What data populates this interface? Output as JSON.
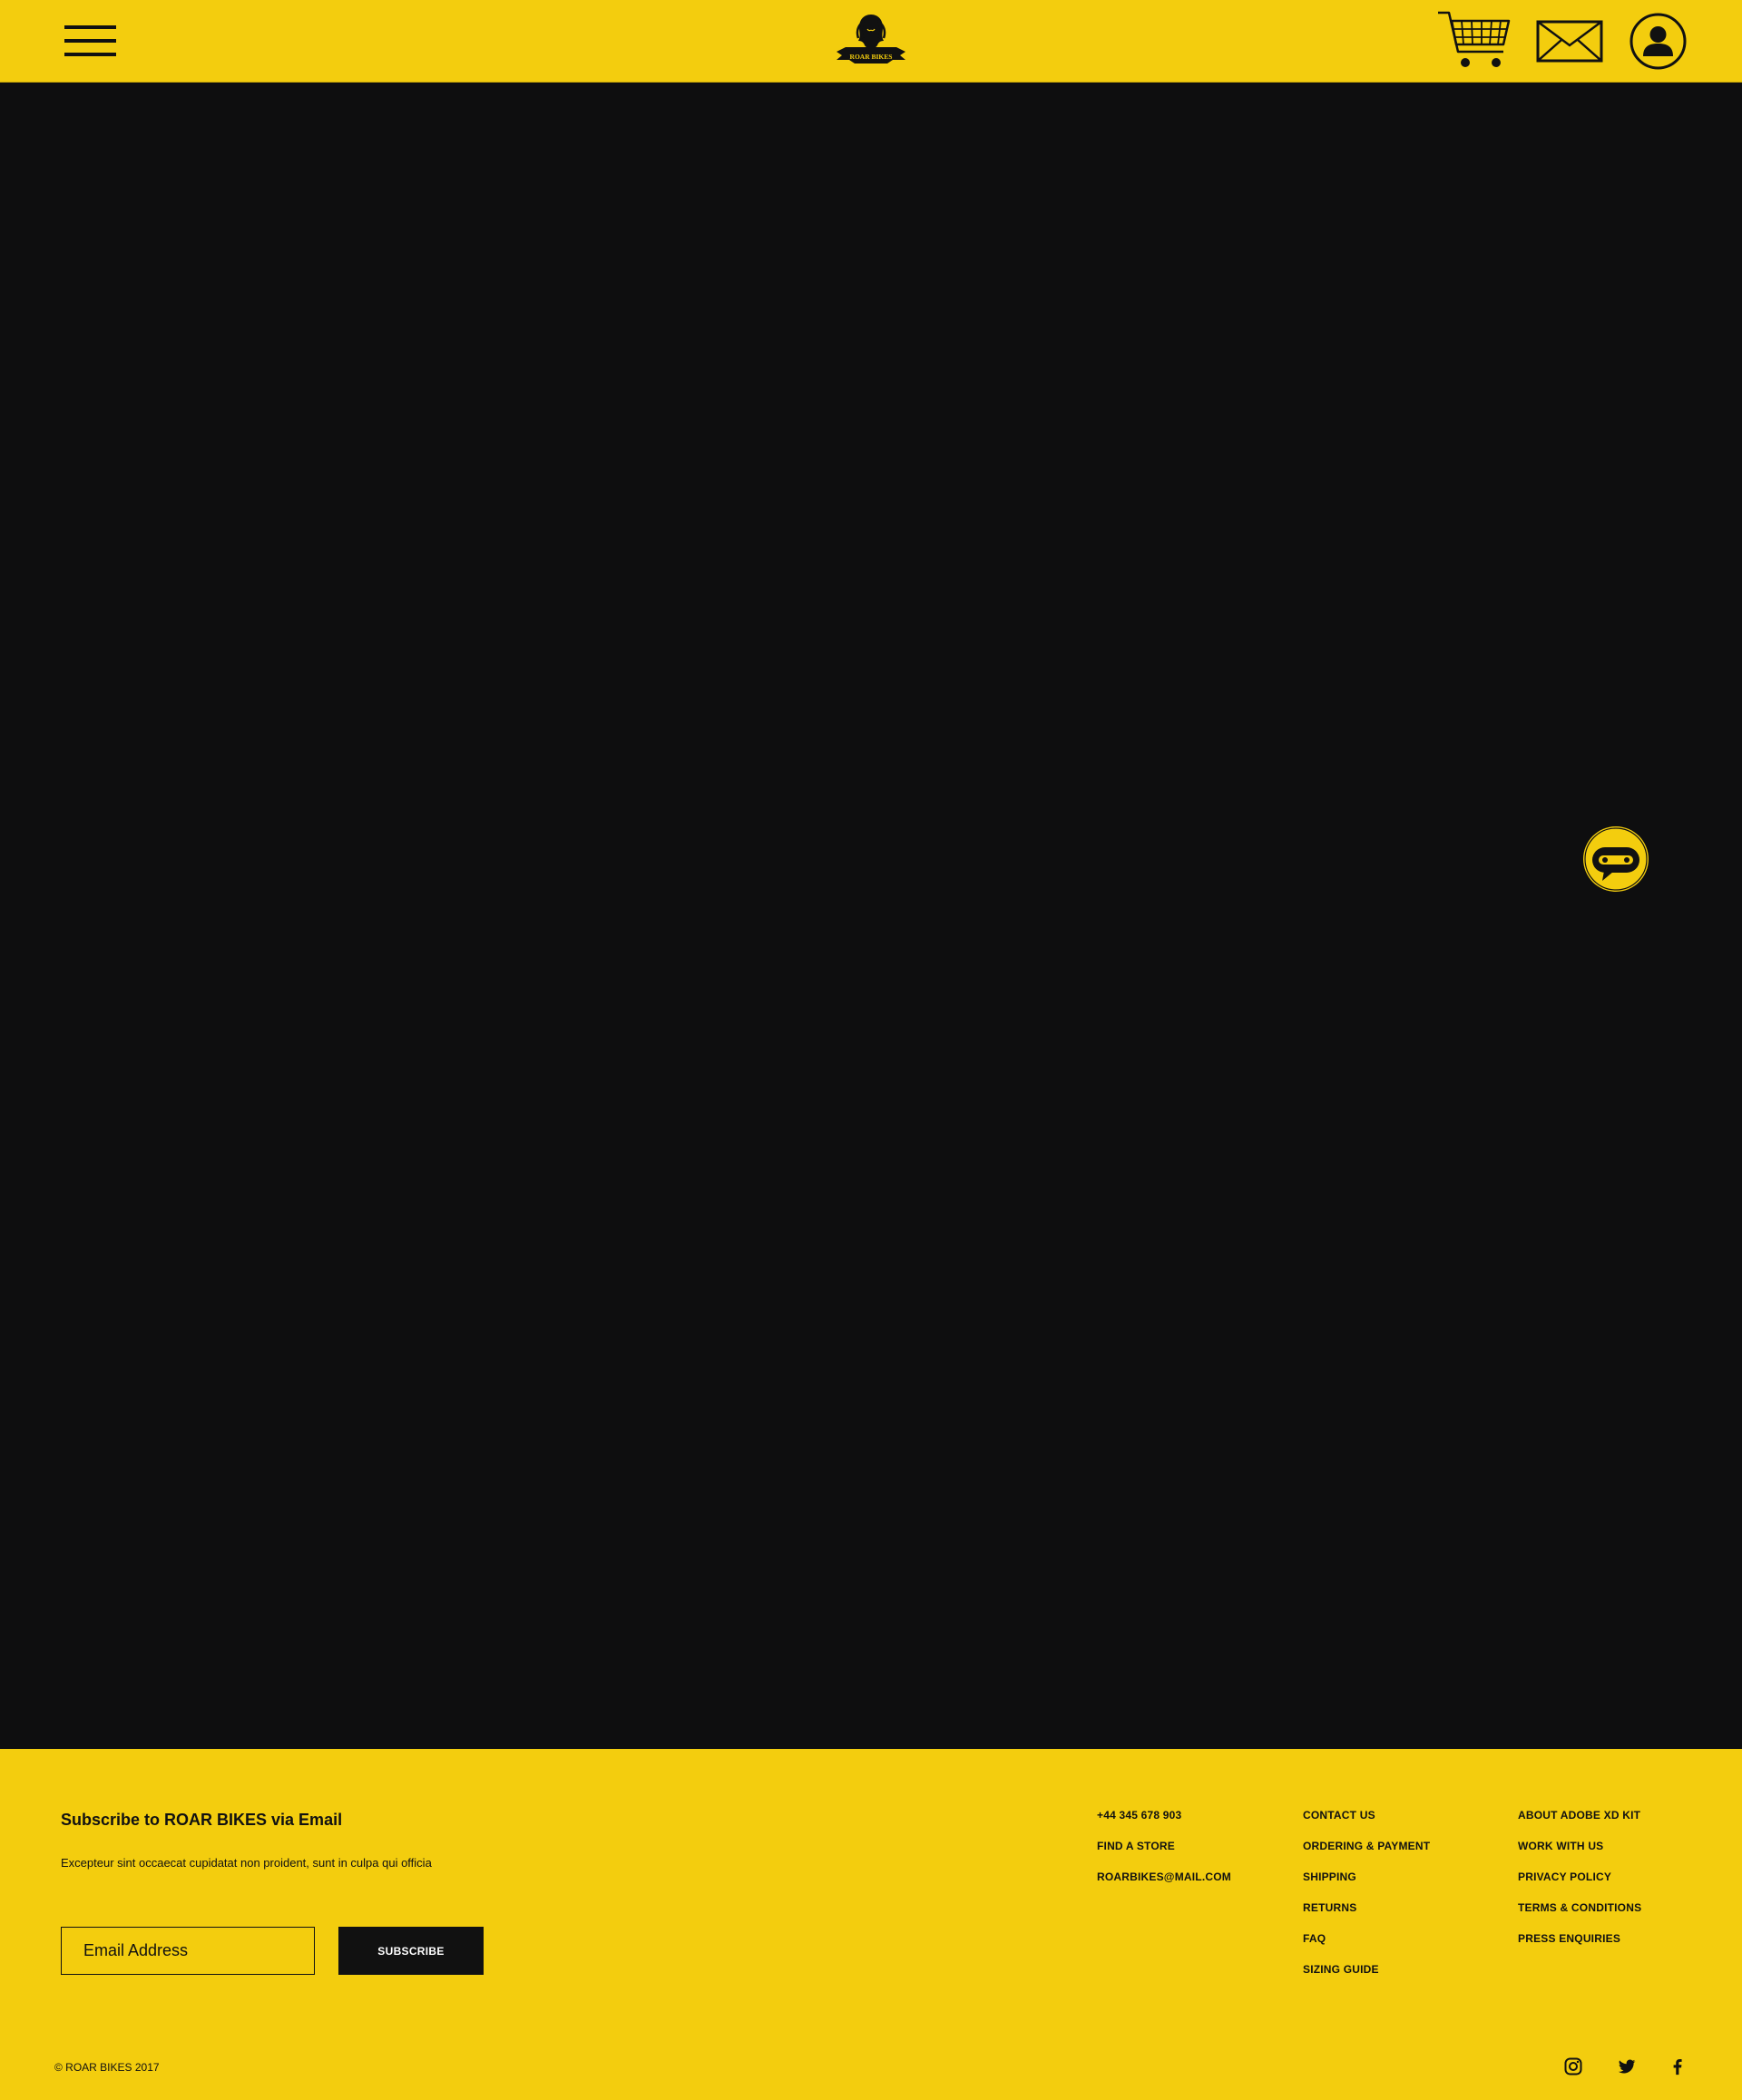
{
  "colors": {
    "brand_yellow": "#f3cd0e",
    "dark": "#0e0e0f",
    "text": "#111111",
    "button_text": "#ffffff"
  },
  "header": {
    "menu_icon": "hamburger-menu-icon",
    "logo_text": "ROAR BIKES",
    "cart_icon": "shopping-cart-icon",
    "mail_icon": "envelope-icon",
    "account_icon": "user-account-icon"
  },
  "chat": {
    "icon": "chat-bubble-icon"
  },
  "footer": {
    "subscribe": {
      "title": "Subscribe to ROAR BIKES via Email",
      "description": "Excepteur sint occaecat cupidatat non proident, sunt in culpa qui officia",
      "email_placeholder": "Email Address",
      "button_label": "SUBSCRIBE"
    },
    "contact_links": [
      "+44 345 678 903",
      "FIND A STORE",
      "ROARBIKES@MAIL.COM"
    ],
    "help_links": [
      "CONTACT US",
      "ORDERING & PAYMENT",
      "SHIPPING",
      "RETURNS",
      "FAQ",
      "SIZING GUIDE"
    ],
    "company_links": [
      "ABOUT ADOBE XD KIT",
      "WORK WITH US",
      "PRIVACY POLICY",
      "TERMS & CONDITIONS",
      "PRESS ENQUIRIES"
    ],
    "copyright": "© ROAR BIKES 2017",
    "social_icons": [
      "instagram-icon",
      "twitter-icon",
      "facebook-icon"
    ]
  }
}
